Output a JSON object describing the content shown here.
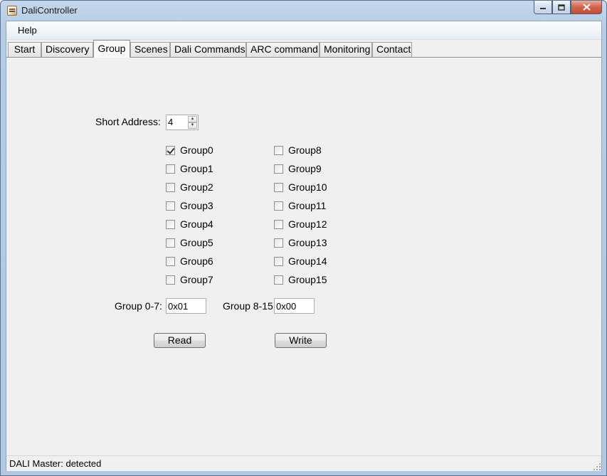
{
  "window": {
    "title": "DaliController"
  },
  "menu": {
    "items": [
      "Help"
    ]
  },
  "tabs": [
    "Start",
    "Discovery",
    "Group",
    "Scenes",
    "Dali Commands",
    "ARC command",
    "Monitoring",
    "Contact"
  ],
  "active_tab": "Group",
  "group_tab": {
    "short_address_label": "Short Address:",
    "short_address_value": "4",
    "groups_left": [
      {
        "label": "Group0",
        "checked": true
      },
      {
        "label": "Group1",
        "checked": false
      },
      {
        "label": "Group2",
        "checked": false
      },
      {
        "label": "Group3",
        "checked": false
      },
      {
        "label": "Group4",
        "checked": false
      },
      {
        "label": "Group5",
        "checked": false
      },
      {
        "label": "Group6",
        "checked": false
      },
      {
        "label": "Group7",
        "checked": false
      }
    ],
    "groups_right": [
      {
        "label": "Group8",
        "checked": false
      },
      {
        "label": "Group9",
        "checked": false
      },
      {
        "label": "Group10",
        "checked": false
      },
      {
        "label": "Group11",
        "checked": false
      },
      {
        "label": "Group12",
        "checked": false
      },
      {
        "label": "Group13",
        "checked": false
      },
      {
        "label": "Group14",
        "checked": false
      },
      {
        "label": "Group15",
        "checked": false
      }
    ],
    "group_0_7_label": "Group 0-7:",
    "group_0_7_value": "0x01",
    "group_8_15_label": "Group 8-15:",
    "group_8_15_value": "0x00",
    "read_label": "Read",
    "write_label": "Write"
  },
  "status": {
    "text": "DALI Master: detected"
  }
}
